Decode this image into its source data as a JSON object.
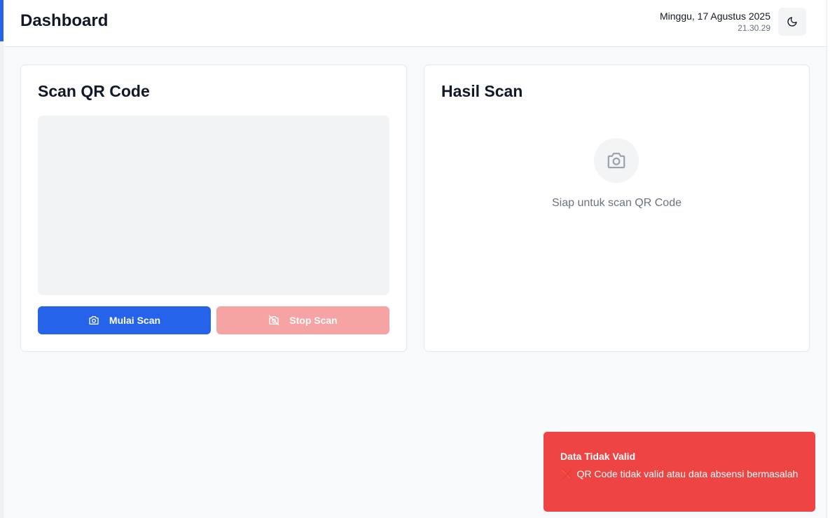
{
  "header": {
    "title": "Dashboard",
    "date": "Minggu, 17 Agustus 2025",
    "time": "21.30.29",
    "theme_icon": "moon-icon"
  },
  "scan_card": {
    "title": "Scan QR Code",
    "start_button": {
      "label": "Mulai Scan",
      "icon": "camera-icon"
    },
    "stop_button": {
      "label": "Stop Scan",
      "icon": "camera-off-icon"
    }
  },
  "result_card": {
    "title": "Hasil Scan",
    "icon": "camera-icon",
    "placeholder": "Siap untuk scan QR Code"
  },
  "toast": {
    "title": "Data Tidak Valid",
    "icon": "cross-mark",
    "icon_glyph": "❌",
    "message": "QR Code tidak valid atau data absensi bermasalah"
  },
  "colors": {
    "accent": "#2563eb",
    "danger": "#ef4444",
    "danger_disabled": "#f5a3a3"
  }
}
